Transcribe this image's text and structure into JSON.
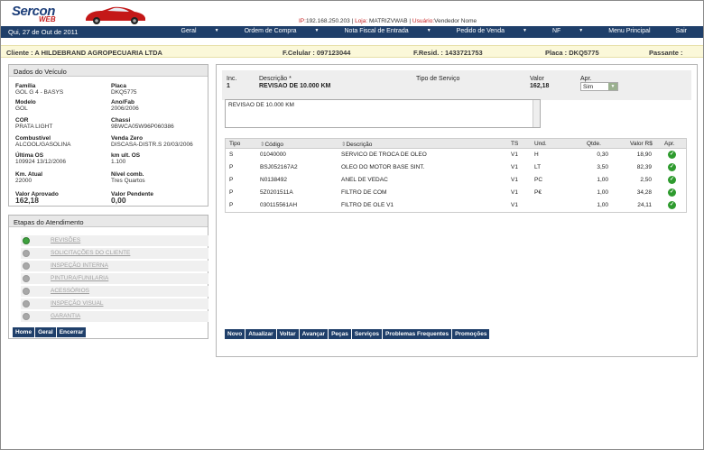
{
  "brand": {
    "name_top": "Sercon",
    "name_bottom": "WEB"
  },
  "session": {
    "ip_label": "IP:",
    "ip": "192.168.250.203",
    "loja_label": "Loja:",
    "loja": "MATRIZVWAB",
    "usuario_label": "Usuário:",
    "usuario": "Vendedor Nome"
  },
  "nav": {
    "date": "Qui, 27 de Out de 2011",
    "items": [
      {
        "label": "Geral",
        "has_dropdown": true
      },
      {
        "label": "Ordem de Compra",
        "has_dropdown": true
      },
      {
        "label": "Nota Fiscal de Entrada",
        "has_dropdown": true
      },
      {
        "label": "Pedido de Venda",
        "has_dropdown": true
      },
      {
        "label": "NF",
        "has_dropdown": true
      },
      {
        "label": "Menu Principal",
        "has_dropdown": false
      },
      {
        "label": "Sair",
        "has_dropdown": false
      }
    ]
  },
  "client": {
    "cliente": "Cliente : A HILDEBRAND AGROPECUARIA LTDA",
    "celular": "F.Celular : 097123044",
    "resid": "F.Resid. : 1433721753",
    "placa": "Placa : DKQ5775",
    "passante": "Passante :"
  },
  "vehicle": {
    "title": "Dados do Veículo",
    "fields": [
      {
        "label": "Família",
        "value": "GOL G 4 - BASYS"
      },
      {
        "label": "Placa",
        "value": "DKQ5775"
      },
      {
        "label": "Modelo",
        "value": "GOL"
      },
      {
        "label": "Ano/Fab",
        "value": "2006/2006"
      },
      {
        "label": "COR",
        "value": "PRATA LIGHT"
      },
      {
        "label": "Chassi",
        "value": "9BWCA05W96P060386"
      },
      {
        "label": "Combustível",
        "value": "ALCOOL/GASOLINA"
      },
      {
        "label": "Venda Zero",
        "value": "DISCASA-DISTR.S 20/03/2006"
      },
      {
        "label": "Última OS",
        "value": "109924 13/12/2006"
      },
      {
        "label": "km ult. OS",
        "value": "1.100"
      },
      {
        "label": "Km. Atual",
        "value": "22000"
      },
      {
        "label": "Nível comb.",
        "value": "Tres Quartos"
      },
      {
        "label": "Valor Aprovado",
        "value": "162,18"
      },
      {
        "label": "Valor Pendente",
        "value": "0,00"
      }
    ]
  },
  "stages": {
    "title": "Etapas do Atendimento",
    "items": [
      {
        "label": "REVISÕES",
        "active": true
      },
      {
        "label": "SOLICITAÇÕES DO CLIENTE",
        "active": false
      },
      {
        "label": "INSPEÇÃO INTERNA",
        "active": false
      },
      {
        "label": "PINTURA/FUNILARIA",
        "active": false
      },
      {
        "label": "ACESSÓRIOS",
        "active": false
      },
      {
        "label": "INSPEÇÃO VISUAL",
        "active": false
      },
      {
        "label": "GARANTIA",
        "active": false
      }
    ],
    "buttons": [
      "Home",
      "Geral",
      "Encerrar"
    ]
  },
  "service": {
    "inc_label": "Inc.",
    "inc": "1",
    "desc_label": "Descrição *",
    "desc": "REVISAO DE 10.000 KM",
    "tipo_label": "Tipo de Serviço",
    "valor_label": "Valor",
    "valor": "162,18",
    "apr_label": "Apr.",
    "apr_value": "Sim",
    "notes": "REVISAO DE 10.000 KM"
  },
  "items_table": {
    "headers": [
      "Tipo",
      "Código",
      "Descrição",
      "TS",
      "Und.",
      "Qtde.",
      "Valor R$",
      "Apr."
    ],
    "rows": [
      {
        "tipo": "S",
        "codigo": "01040000",
        "descricao": "SERVICO DE TROCA DE OLEO",
        "ts": "V1",
        "und": "H",
        "qtde": "0,30",
        "valor": "18,90"
      },
      {
        "tipo": "P",
        "codigo": "BSJ052167A2",
        "descricao": "OLEO DO MOTOR BASE SINT.",
        "ts": "V1",
        "und": "LT",
        "qtde": "3,50",
        "valor": "82,39"
      },
      {
        "tipo": "P",
        "codigo": "N0138492",
        "descricao": "ANEL DE VEDAC",
        "ts": "V1",
        "und": "PC",
        "qtde": "1,00",
        "valor": "2,50"
      },
      {
        "tipo": "P",
        "codigo": "5Z0201511A",
        "descricao": "FILTRO DE COM",
        "ts": "V1",
        "und": "P€",
        "qtde": "1,00",
        "valor": "34,28"
      },
      {
        "tipo": "P",
        "codigo": "030115561AH",
        "descricao": "FILTRO DE OLE V1",
        "ts": "V1",
        "und": "",
        "qtde": "1,00",
        "valor": "24,11"
      }
    ]
  },
  "actions": [
    "Novo",
    "Atualizar",
    "Voltar",
    "Avançar",
    "Peças",
    "Serviços",
    "Problemas Frequentes",
    "Promoções"
  ],
  "colors": {
    "navy": "#1f3f6a",
    "brand_red": "#c62020",
    "client_bar": "#fbf8d9",
    "ok_green": "#2e9b2e"
  }
}
